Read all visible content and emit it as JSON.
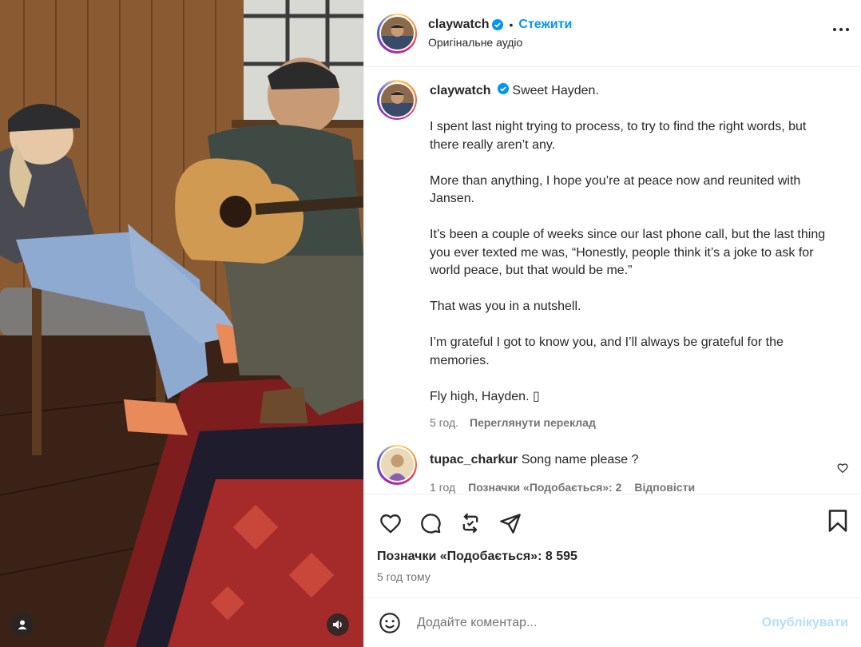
{
  "post": {
    "username": "claywatch",
    "follow_label": "Стежити",
    "audio_label": "Оригінальне аудіо"
  },
  "caption": {
    "username": "claywatch",
    "paragraphs": [
      "Sweet Hayden.",
      "I spent last night trying to process, to try to find the right words, but there really aren’t any.",
      "More than anything, I hope you’re at peace now and reunited with Jansen.",
      "It’s been a couple of weeks since our last phone call, but the last thing you ever texted me was, “Honestly, people think it’s a joke to ask for world peace, but that would be me.”",
      "That was you in a nutshell.",
      "I’m grateful I got to know you, and I’ll always be grateful for the memories.",
      "Fly high, Hayden. ▯"
    ],
    "age": "5 год.",
    "translate_label": "Переглянути переклад"
  },
  "comment": {
    "username": "tupac_charkur",
    "text": "Song name please ?",
    "age": "1 год",
    "likes_label": "Позначки «Подобається»: 2",
    "reply_label": "Відповісти"
  },
  "actions": {
    "likes_label": "Позначки «Подобається»: 8 595",
    "time_ago": "5 год тому"
  },
  "add_comment": {
    "placeholder": "Додайте коментар...",
    "publish_label": "Опублікувати"
  },
  "icons": {
    "verified": "verified-badge-icon",
    "more": "more-options-icon",
    "like": "heart-icon",
    "comment": "comment-icon",
    "repost": "repost-icon",
    "share": "share-icon",
    "save": "bookmark-icon",
    "emoji": "emoji-icon",
    "user_tags": "user-tag-icon",
    "audio": "speaker-icon"
  },
  "colors": {
    "accent": "#0095f6",
    "publish_disabled": "#b2dffc",
    "muted_text": "#737373"
  }
}
